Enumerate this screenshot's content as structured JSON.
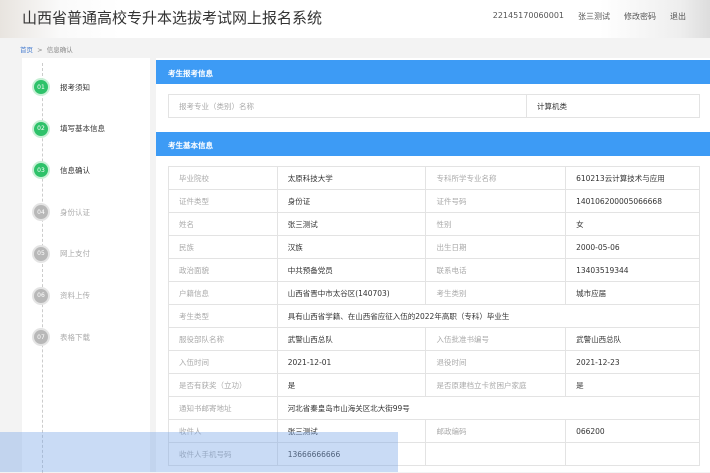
{
  "header": {
    "title": "山西省普通高校专升本选拔考试网上报名系统",
    "user_id": "22145170060001",
    "user_name": "张三测试",
    "change_password": "修改密码",
    "logout": "退出"
  },
  "breadcrumb": {
    "home": "首页",
    "sep": ">",
    "current": "信息确认"
  },
  "steps": [
    {
      "num": "01",
      "label": "报考须知",
      "done": true
    },
    {
      "num": "02",
      "label": "填写基本信息",
      "done": true
    },
    {
      "num": "03",
      "label": "信息确认",
      "done": true
    },
    {
      "num": "04",
      "label": "身份认证",
      "done": false
    },
    {
      "num": "05",
      "label": "网上支付",
      "done": false
    },
    {
      "num": "06",
      "label": "资料上传",
      "done": false
    },
    {
      "num": "07",
      "label": "表格下载",
      "done": false
    }
  ],
  "section1": {
    "title": "考生报考信息",
    "label": "报考专业（类别）名称",
    "value": "计算机类"
  },
  "section2": {
    "title": "考生基本信息",
    "rows": [
      [
        "毕业院校",
        "太原科技大学",
        "专科所学专业名称",
        "610213云计算技术与应用"
      ],
      [
        "证件类型",
        "身份证",
        "证件号码",
        "140106200005066668"
      ],
      [
        "姓名",
        "张三测试",
        "性别",
        "女"
      ],
      [
        "民族",
        "汉族",
        "出生日期",
        "2000-05-06"
      ],
      [
        "政治面貌",
        "中共预备党员",
        "联系电话",
        "13403519344"
      ],
      [
        "户籍信息",
        "山西省晋中市太谷区(140703)",
        "考生类别",
        "城市应届"
      ],
      [
        "考生类型",
        "具有山西省学籍、在山西省应征入伍的2022年高职（专科）毕业生"
      ],
      [
        "服役部队名称",
        "武警山西总队",
        "入伍批准书编号",
        "武警山西总队"
      ],
      [
        "入伍时间",
        "2021-12-01",
        "退役时间",
        "2021-12-23"
      ],
      [
        "是否有获奖（立功）",
        "是",
        "是否原建档立卡贫困户家庭",
        "是"
      ],
      [
        "通知书邮寄地址",
        "河北省秦皇岛市山海关区北大街99号"
      ],
      [
        "收件人",
        "张三测试",
        "邮政编码",
        "066200"
      ],
      [
        "收件人手机号码",
        "13666666666",
        "",
        ""
      ]
    ]
  }
}
